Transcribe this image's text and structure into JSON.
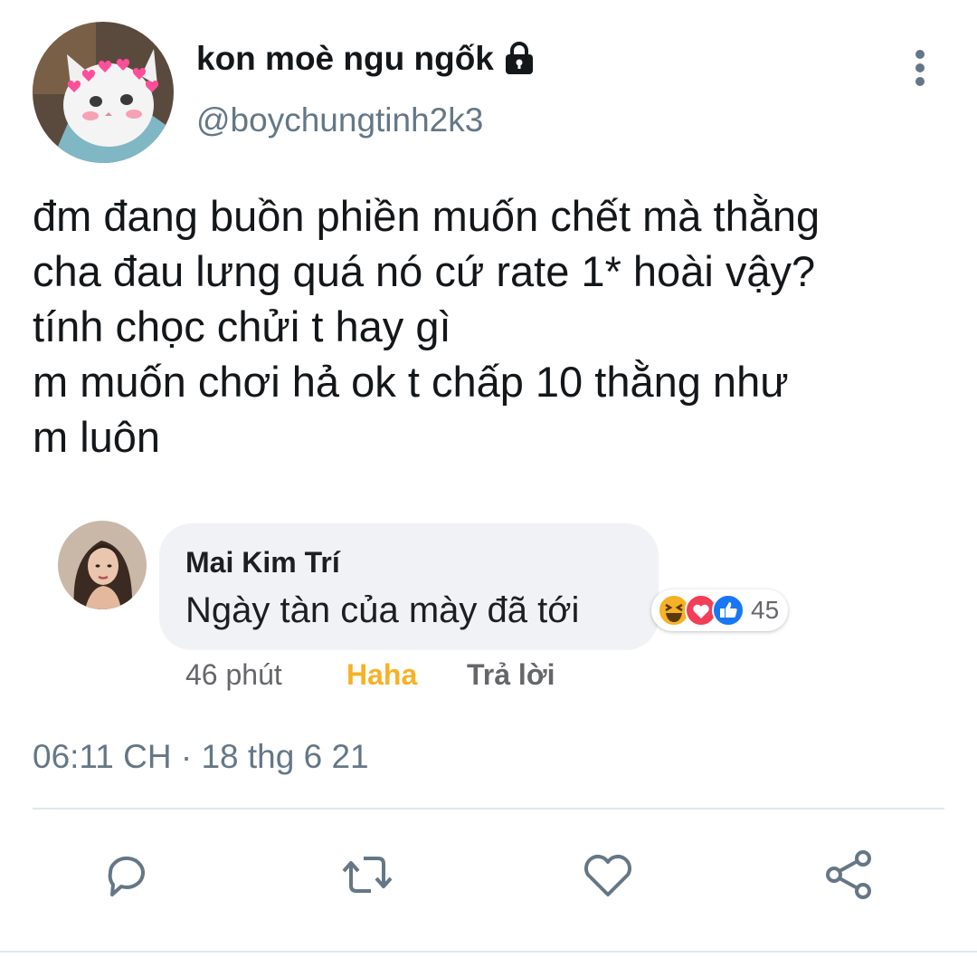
{
  "tweet": {
    "display_name": "kon moè ngu ngốk",
    "handle": "@boychungtinh2k3",
    "lines": [
      "đm đang buồn phiền muốn chết mà thằng",
      "cha đau lưng quá nó cứ rate 1* hoài vậy?",
      "tính chọc chửi t hay gì",
      "m muốn chơi hả ok t chấp 10 thằng như",
      "m luôn"
    ],
    "timestamp": "06:11 CH · 18 thg 6 21",
    "icons": {
      "protected": "lock-icon",
      "more": "more-vertical-icon",
      "actions": [
        "reply-icon",
        "retweet-icon",
        "like-icon",
        "share-icon"
      ]
    }
  },
  "embedded_comment": {
    "author": "Mai Kim Trí",
    "text": "Ngày tàn của mày đã tới",
    "reaction_count": "45",
    "reactions": [
      "haha",
      "love",
      "like"
    ],
    "time": "46 phút",
    "reaction_label": "Haha",
    "reply_label": "Trả lời"
  },
  "colors": {
    "text": "#14171a",
    "secondary": "#657786",
    "divider": "#e1e8ed",
    "haha": "#f7b125",
    "like_blue": "#1877f2",
    "love_red": "#f33e58"
  }
}
